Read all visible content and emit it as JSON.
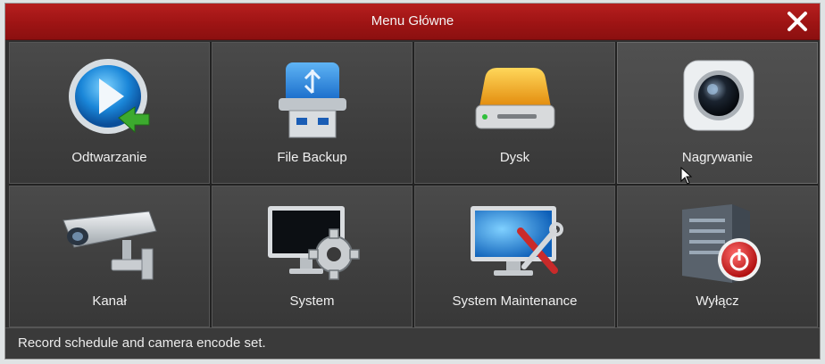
{
  "window": {
    "title": "Menu Główne",
    "close_icon": "close-icon"
  },
  "menu": {
    "items": [
      {
        "label": "Odtwarzanie",
        "icon": "playback-icon"
      },
      {
        "label": "File Backup",
        "icon": "usb-drive-icon"
      },
      {
        "label": "Dysk",
        "icon": "hard-disk-icon"
      },
      {
        "label": "Nagrywanie",
        "icon": "camera-lens-icon"
      },
      {
        "label": "Kanał",
        "icon": "cctv-camera-icon"
      },
      {
        "label": "System",
        "icon": "monitor-gear-icon"
      },
      {
        "label": "System Maintenance",
        "icon": "monitor-tools-icon"
      },
      {
        "label": "Wyłącz",
        "icon": "server-power-icon"
      }
    ]
  },
  "status": {
    "text": "Record schedule and camera encode set."
  },
  "colors": {
    "titlebar": "#b61f1f",
    "tile": "#444444",
    "accent_blue": "#1e8fe0"
  }
}
